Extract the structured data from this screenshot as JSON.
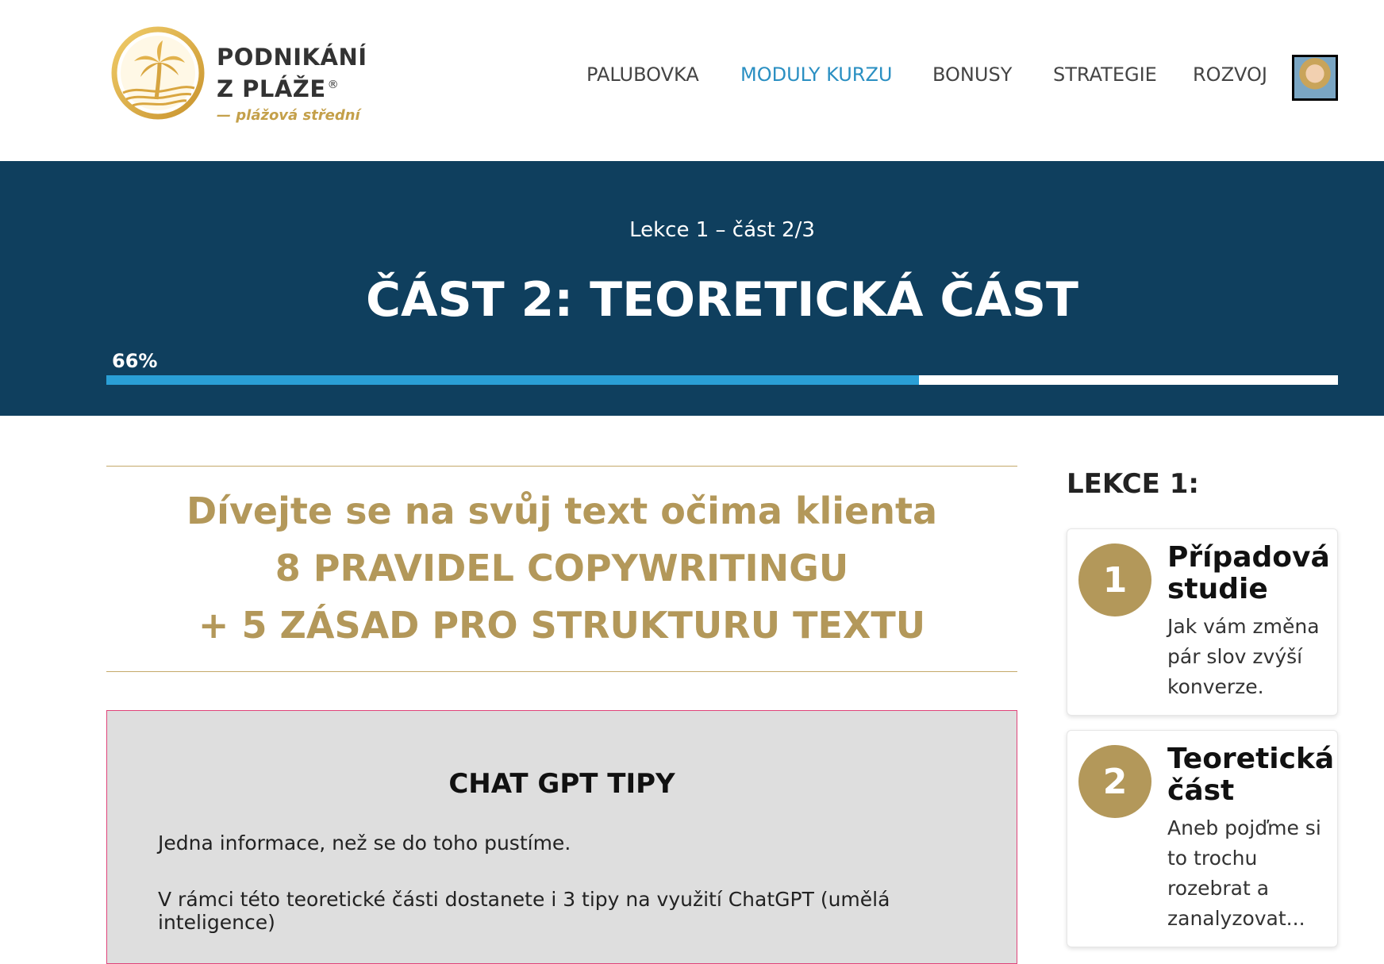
{
  "header": {
    "brand_line1": "PODNIKÁNÍ",
    "brand_line2": "Z PLÁŽE",
    "registered_mark": "®",
    "tagline": "— plážová střední",
    "nav": [
      {
        "label": "PALUBOVKA",
        "active": false
      },
      {
        "label": "MODULY KURZU",
        "active": true
      },
      {
        "label": "BONUSY",
        "active": false
      },
      {
        "label": "STRATEGIE",
        "active": false
      },
      {
        "label": "ROZVOJ",
        "active": false
      }
    ],
    "colors": {
      "active_nav": "#2a8fc2",
      "brand_gold": "#c4a04a"
    }
  },
  "banner": {
    "kicker": "Lekce 1 – část 2/3",
    "title": "ČÁST 2: TEORETICKÁ ČÁST",
    "progress_label": "66%",
    "progress_fraction": 0.66,
    "colors": {
      "background": "#0f3f5e",
      "progress_fill": "#2a9fd6"
    }
  },
  "main": {
    "hero_line1": "Dívejte se na svůj text očima klienta",
    "hero_line2": "8 PRAVIDEL COPYWRITINGU",
    "hero_line3": "+ 5 ZÁSAD PRO STRUKTURU TEXTU",
    "tips_title": "CHAT GPT TIPY",
    "tips_p1": "Jedna informace, než se do toho pustíme.",
    "tips_p2": "V rámci této teoretické části dostanete i 3 tipy na využití ChatGPT (umělá inteligence)"
  },
  "sidebar": {
    "heading": "LEKCE 1:",
    "lessons": [
      {
        "number": "1",
        "title": "Případová studie",
        "description": "Jak vám změna pár slov zvýší konverze."
      },
      {
        "number": "2",
        "title": "Teoretická část",
        "description": "Aneb pojďme si to trochu rozebrat a zanalyzovat..."
      }
    ]
  }
}
